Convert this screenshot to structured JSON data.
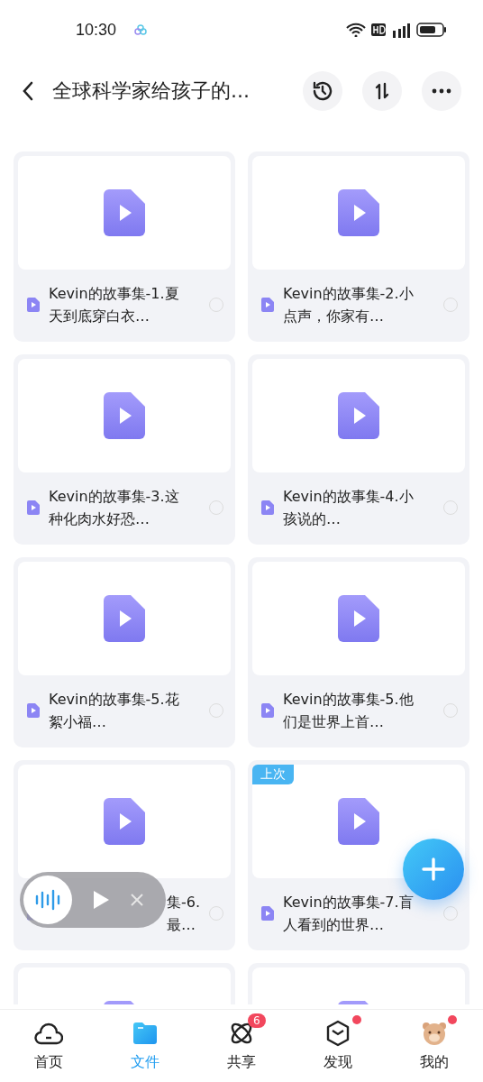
{
  "status_bar": {
    "time": "10:30"
  },
  "header": {
    "title": "全球科学家给孩子的..."
  },
  "files": [
    {
      "name": "Kevin的故事集-1.夏天到底穿白衣…",
      "selected": false
    },
    {
      "name": "Kevin的故事集-2.小点声，你家有…",
      "selected": false
    },
    {
      "name": "Kevin的故事集-3.这种化肉水好恐…",
      "selected": false
    },
    {
      "name": "Kevin的故事集-4.小孩说的…",
      "selected": false
    },
    {
      "name": "Kevin的故事集-5.花絮小福…",
      "selected": false
    },
    {
      "name": "Kevin的故事集-5.他们是世界上首…",
      "selected": false
    },
    {
      "kind": "covered",
      "lines": [
        "集-6.",
        "最…"
      ],
      "selected": false
    },
    {
      "name": "Kevin的故事集-7.盲人看到的世界…",
      "selected": false,
      "badge": "上次"
    },
    {
      "kind": "partial"
    },
    {
      "kind": "partial"
    }
  ],
  "tabs": [
    {
      "label": "首页",
      "selected": false
    },
    {
      "label": "文件",
      "selected": true
    },
    {
      "label": "共享",
      "selected": false,
      "badge": "6"
    },
    {
      "label": "发现",
      "selected": false,
      "dot": true
    },
    {
      "label": "我的",
      "selected": false,
      "dot": true
    }
  ]
}
